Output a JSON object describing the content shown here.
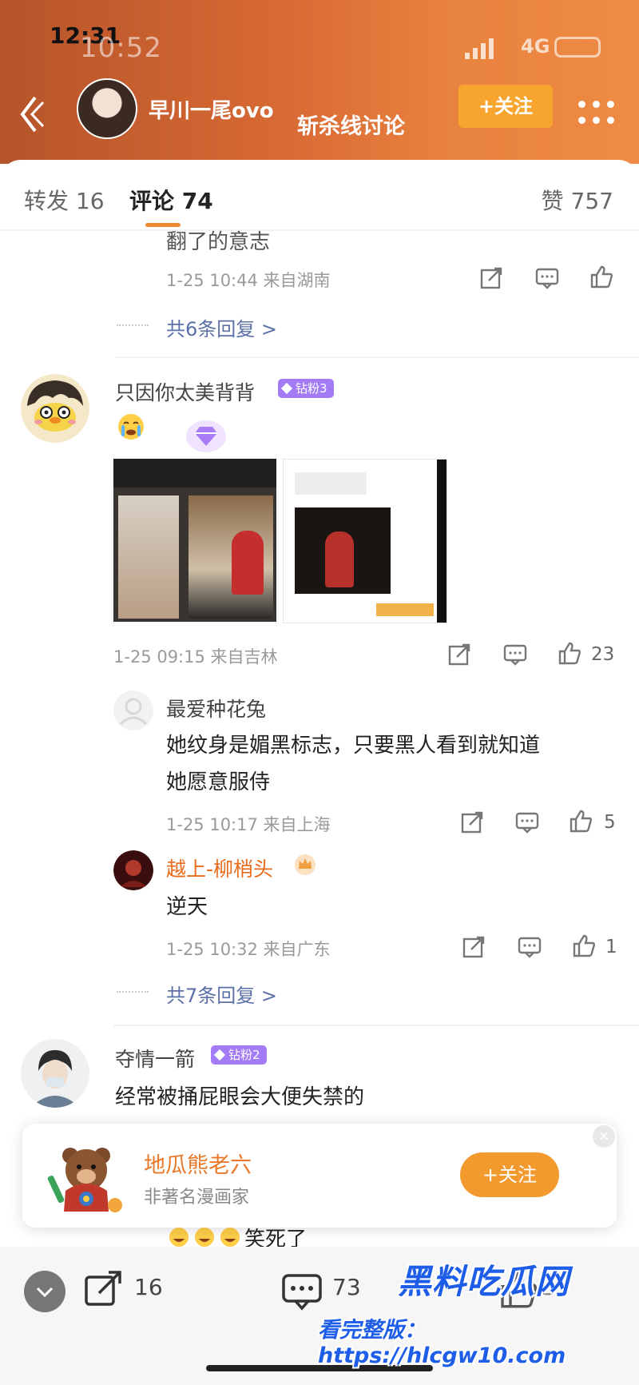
{
  "status": {
    "time_front": "12:31",
    "time_back": "10:52"
  },
  "header": {
    "author": "早川一尾ovo",
    "title": "斩杀线讨论",
    "follow_label": "+关注"
  },
  "tabs": {
    "forward": "转发 16",
    "comments": "评论 74",
    "likes": "赞 757"
  },
  "comments": {
    "prev_tail_text": "翻了的意志",
    "prev_meta": "1-25 10:44 来自湖南",
    "prev_replies": "共6条回复 >",
    "c1": {
      "user": "只因你太美背背",
      "badge": "钻粉3",
      "meta": "1-25 09:15 来自吉林",
      "likes": "23",
      "replies": [
        {
          "user": "最爱种花兔",
          "text_l1": "她纹身是媚黑标志，只要黑人看到就知道",
          "text_l2": "她愿意服侍",
          "meta": "1-25 10:17 来自上海",
          "likes": "5"
        },
        {
          "user": "越上-柳梢头",
          "text_l1": "逆天",
          "meta": "1-25 10:32 来自广东",
          "likes": "1"
        }
      ],
      "replies_link": "共7条回复 >"
    },
    "c2": {
      "user": "夺情一箭",
      "badge": "钻粉2",
      "text": "经常被捅屁眼会大便失禁的",
      "hidden_tail": "笑死了"
    }
  },
  "popup": {
    "name": "地瓜熊老六",
    "desc": "非著名漫画家",
    "follow_label": "+关注",
    "close": "×"
  },
  "bottom": {
    "forwards": "16",
    "comments": "73",
    "likes": "57"
  },
  "watermark": {
    "title": "黑料吃瓜网",
    "url": "看完整版：https://hlcgw10.com"
  },
  "colors": {
    "header_gradient_start": "#b5542a",
    "header_gradient_end": "#ef8b44",
    "accent_orange": "#f08a32",
    "badge_purple": "#a27bf5",
    "link_blue": "#5b6fa8"
  }
}
